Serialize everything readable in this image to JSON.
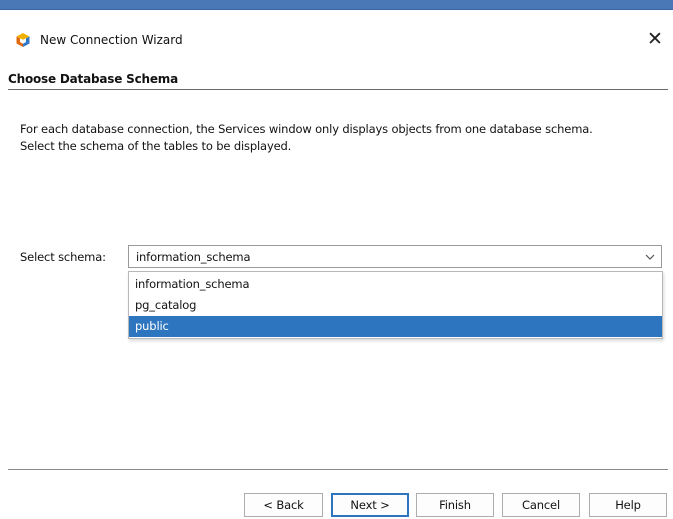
{
  "window": {
    "title": "New Connection Wizard",
    "close_glyph": "✕"
  },
  "step": {
    "title": "Choose Database Schema",
    "description_lines": [
      "For each database connection, the Services window only displays objects from one database schema.",
      "Select the schema of the tables to be displayed."
    ]
  },
  "schema": {
    "label": "Select schema:",
    "selected_value": "information_schema",
    "options": [
      {
        "label": "information_schema",
        "highlighted": false
      },
      {
        "label": "pg_catalog",
        "highlighted": false
      },
      {
        "label": "public",
        "highlighted": true
      }
    ]
  },
  "buttons": {
    "back": "< Back",
    "next": "Next >",
    "finish": "Finish",
    "cancel": "Cancel",
    "help": "Help"
  },
  "icons": {
    "app": "netbeans-cube-icon",
    "close": "close-icon",
    "dropdown": "chevron-down-icon"
  },
  "colors": {
    "accent": "#2e75c0",
    "title_strip": "#4a78b6"
  }
}
